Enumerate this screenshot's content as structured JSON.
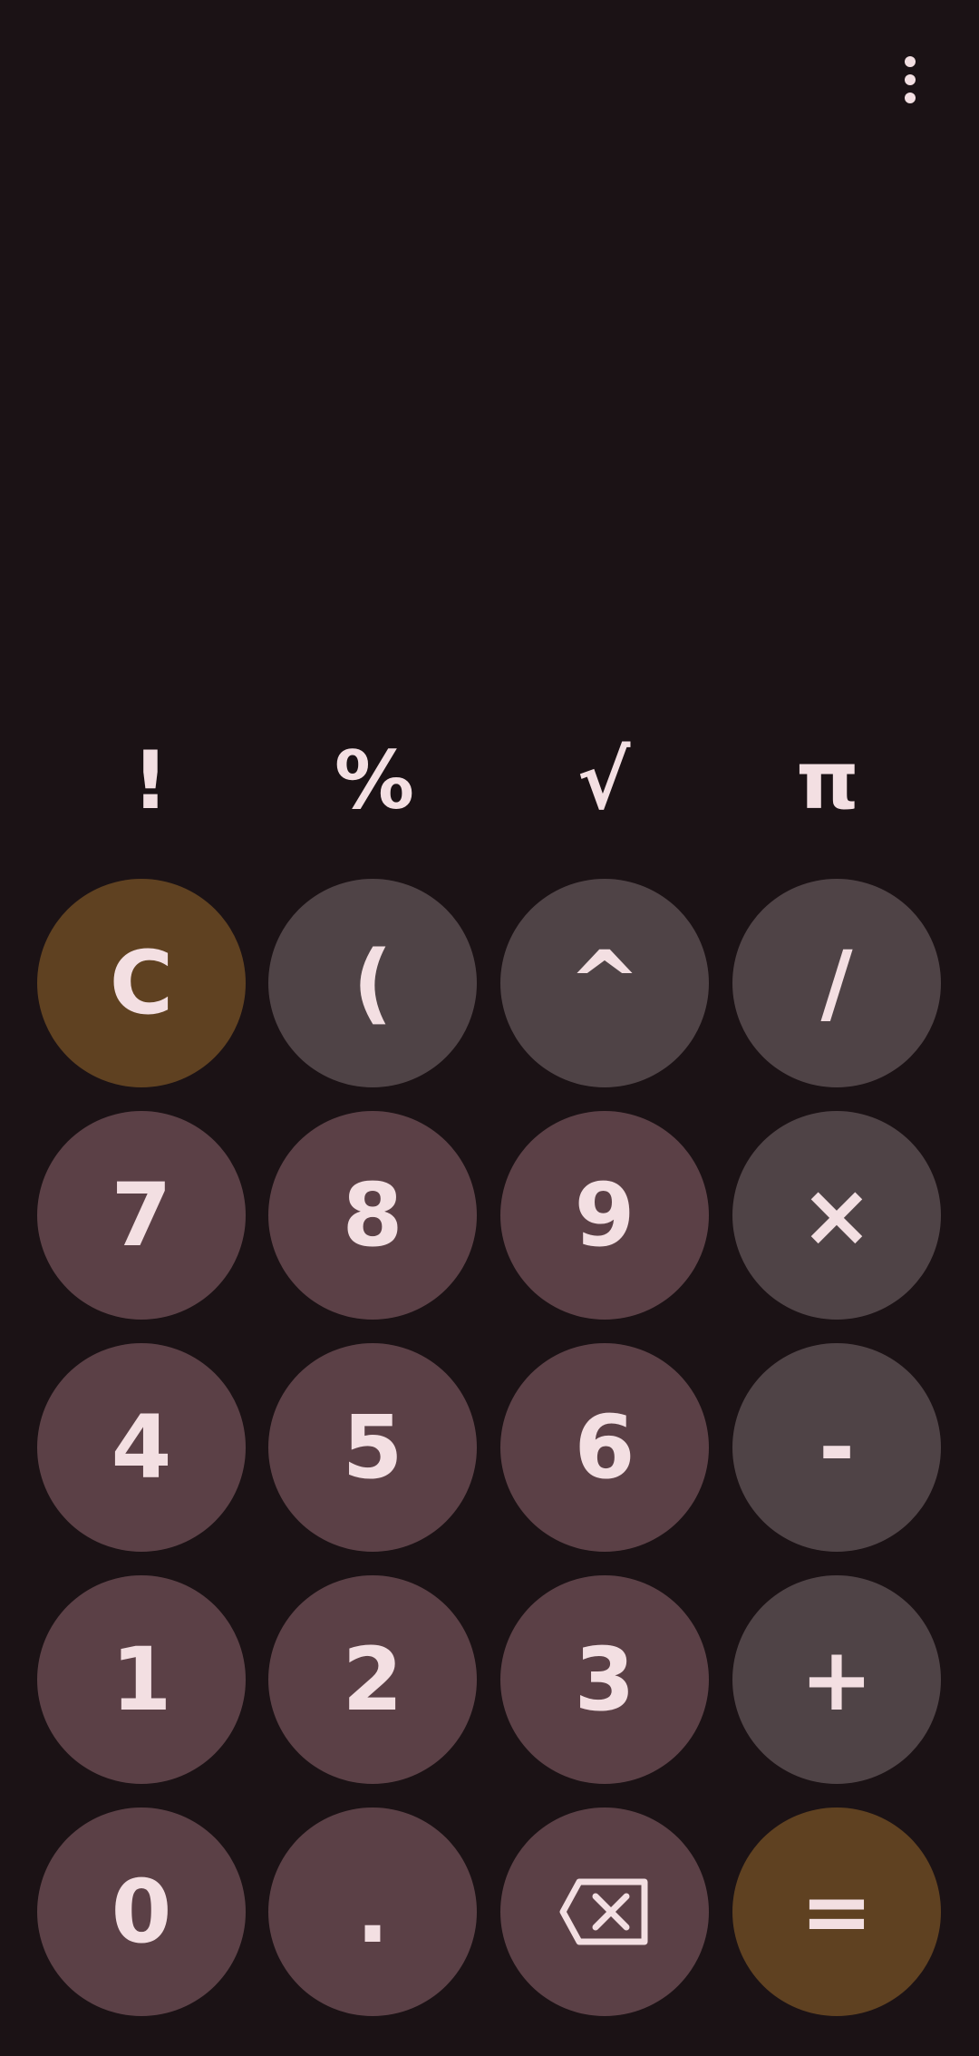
{
  "app": {
    "menu_icon": "more-vert-icon"
  },
  "display": {
    "expression": "",
    "result": ""
  },
  "colors": {
    "background": "#1b1215",
    "text": "#f3dfe2",
    "digit_key": "#5b4046",
    "operator_key": "#4f4346",
    "accent_key": "#5f4121"
  },
  "scientific_keys": {
    "factorial": "!",
    "percent": "%",
    "sqrt": "√",
    "pi": "π"
  },
  "keys": {
    "clear": "C",
    "paren": "(",
    "power": "^",
    "divide": "/",
    "seven": "7",
    "eight": "8",
    "nine": "9",
    "multiply": "×",
    "four": "4",
    "five": "5",
    "six": "6",
    "subtract": "-",
    "one": "1",
    "two": "2",
    "three": "3",
    "add": "+",
    "zero": "0",
    "decimal": ".",
    "backspace_icon": "backspace-icon",
    "equals": "="
  }
}
